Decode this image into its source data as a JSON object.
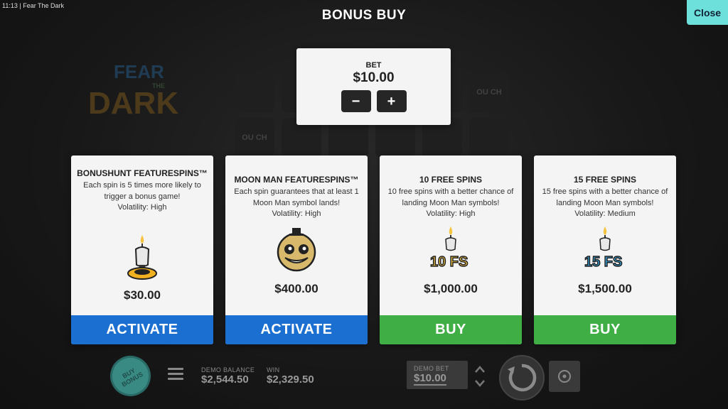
{
  "status_bar": {
    "time": "11:13",
    "app_name": "Fear The Dark"
  },
  "header": {
    "title": "BONUS BUY",
    "close_label": "Close"
  },
  "bet": {
    "label": "BET",
    "value": "$10.00",
    "minus": "−",
    "plus": "+"
  },
  "cards": [
    {
      "title": "BONUSHUNT FEATURESPINS™",
      "description": "Each spin is 5 times more likely to trigger a bonus game!",
      "volatility": "Volatility: High",
      "price": "$30.00",
      "action": "ACTIVATE",
      "action_color": "#1a6fd1",
      "icon": "candle-icon"
    },
    {
      "title": "MOON MAN FEATURESPINS™",
      "description": "Each spin guarantees that at least 1 Moon Man symbol lands!",
      "volatility": "Volatility: High",
      "price": "$400.00",
      "action": "ACTIVATE",
      "action_color": "#1a6fd1",
      "icon": "moon-man-icon"
    },
    {
      "title": "10 FREE SPINS",
      "description": "10 free spins with a better chance of landing Moon Man symbols!",
      "volatility": "Volatility: High",
      "price": "$1,000.00",
      "action": "BUY",
      "action_color": "#3fae45",
      "icon": "10fs-icon",
      "badge": "10 FS"
    },
    {
      "title": "15 FREE SPINS",
      "description": "15 free spins with a better chance of landing Moon Man symbols!",
      "volatility": "Volatility: Medium",
      "price": "$1,500.00",
      "action": "BUY",
      "action_color": "#3fae45",
      "icon": "15fs-icon",
      "badge": "15 FS"
    }
  ],
  "bottom_bar": {
    "buy_bonus_label": "BUY BONUS",
    "demo_balance_label": "DEMO BALANCE",
    "demo_balance_value": "$2,544.50",
    "win_label": "WIN",
    "win_value": "$2,329.50",
    "demo_bet_label": "DEMO BET",
    "demo_bet_value": "$10.00"
  },
  "background": {
    "logo_text_top": "FEAR",
    "logo_text_mid": "THE",
    "logo_text_bottom": "DARK",
    "reel_symbol_text": "OU CH"
  }
}
